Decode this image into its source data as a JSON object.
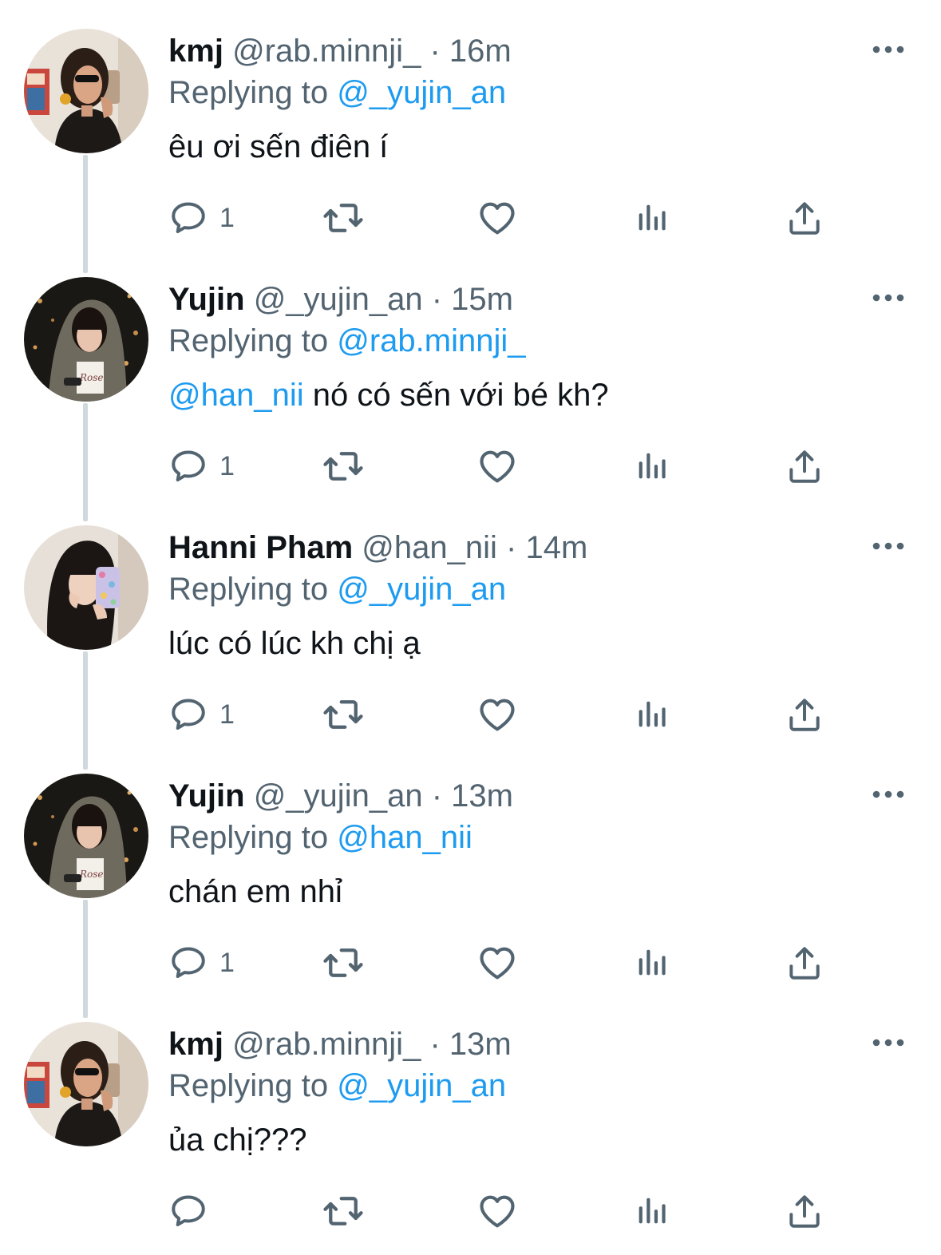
{
  "colors": {
    "text_primary": "#0f1419",
    "text_secondary": "#536471",
    "link": "#1d9bf0",
    "thread_line": "#cfd9de",
    "icon": "#536471"
  },
  "icons": {
    "more": "more-horizontal-icon",
    "reply": "speech-bubble-icon",
    "retweet": "retweet-arrows-icon",
    "like": "heart-outline-icon",
    "views": "bar-chart-icon",
    "share": "upload-arrow-icon"
  },
  "separator": "·",
  "replying_prefix": "Replying to",
  "tweets": [
    {
      "name": "kmj",
      "handle": "@rab.minnji_",
      "time": "16m",
      "replying_to": "@_yujin_an",
      "mention": "",
      "text": "êu ơi sến điên í",
      "reply_count": "1"
    },
    {
      "name": "Yujin",
      "handle": "@_yujin_an",
      "time": "15m",
      "replying_to": "@rab.minnji_",
      "mention": "@han_nii",
      "text": " nó có sến với bé kh?",
      "reply_count": "1"
    },
    {
      "name": "Hanni Pham",
      "handle": "@han_nii",
      "time": "14m",
      "replying_to": "@_yujin_an",
      "mention": "",
      "text": "lúc có lúc kh chị ạ",
      "reply_count": "1"
    },
    {
      "name": "Yujin",
      "handle": "@_yujin_an",
      "time": "13m",
      "replying_to": "@han_nii",
      "mention": "",
      "text": "chán em nhỉ",
      "reply_count": "1"
    },
    {
      "name": "kmj",
      "handle": "@rab.minnji_",
      "time": "13m",
      "replying_to": "@_yujin_an",
      "mention": "",
      "text": "ủa chị???",
      "reply_count": ""
    }
  ]
}
